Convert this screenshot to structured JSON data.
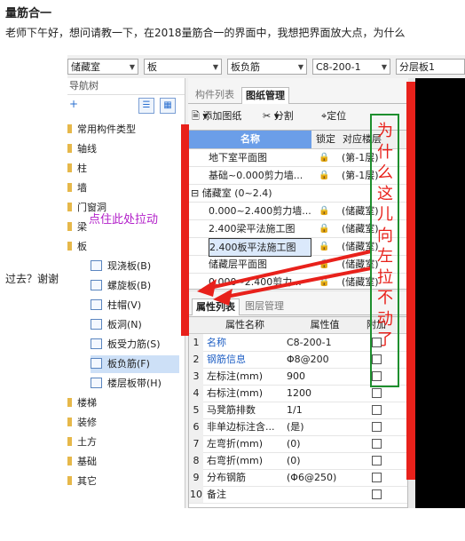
{
  "post": {
    "title": "量筋合一",
    "question_line1": "老师下午好，想问请教一下，在2018量筋合一的界面中，我想把界面放大点，为什么",
    "question_line2": "过去？谢谢"
  },
  "combos": [
    "储藏室",
    "板",
    "板负筋",
    "C8-200-1",
    "分层板1"
  ],
  "nav": {
    "header": "导航树",
    "add": "+",
    "categories": [
      "常用构件类型",
      "轴线",
      "柱",
      "墙",
      "门窗洞",
      "梁",
      "板",
      "楼梯",
      "装修",
      "土方",
      "基础",
      "其它"
    ],
    "sub_items": [
      "现浇板(B)",
      "螺旋板(B)",
      "柱帽(V)",
      "板洞(N)",
      "板受力筋(S)",
      "板负筋(F)",
      "楼层板带(H)"
    ],
    "selected": "板负筋(F)"
  },
  "upper_tabs": [
    "构件列表",
    "图纸管理"
  ],
  "toolbar": {
    "add_drawing": "添加图纸",
    "split": "分割",
    "locate": "定位"
  },
  "drawing_grid": {
    "headers": [
      "名称",
      "锁定",
      "对应楼层"
    ],
    "rows": [
      {
        "name": "地下室平面图",
        "floor": "(第-1层)"
      },
      {
        "name": "基础~0.000剪力墙...",
        "floor": "(第-1层)"
      },
      {
        "name": "储藏室 (0~2.4)",
        "group": true
      },
      {
        "name": "0.000~2.400剪力墙...",
        "floor": "(储藏室)"
      },
      {
        "name": "2.400梁平法施工图",
        "floor": "(储藏室)"
      },
      {
        "name": "2.400板平法施工图",
        "floor": "(储藏室)",
        "selected": true
      },
      {
        "name": "储藏层平面图",
        "floor": "(储藏室)"
      },
      {
        "name": "0.000~2.400剪力...",
        "floor": "(储藏室)"
      }
    ]
  },
  "lower_tabs": [
    "属性列表",
    "图层管理"
  ],
  "properties": {
    "headers": [
      "属性名称",
      "属性值",
      "附加"
    ],
    "rows": [
      {
        "i": "1",
        "name": "名称",
        "value": "C8-200-1",
        "blue": true
      },
      {
        "i": "2",
        "name": "钢筋信息",
        "value": "Φ8@200",
        "blue": true
      },
      {
        "i": "3",
        "name": "左标注(mm)",
        "value": "900"
      },
      {
        "i": "4",
        "name": "右标注(mm)",
        "value": "1200"
      },
      {
        "i": "5",
        "name": "马凳筋排数",
        "value": "1/1"
      },
      {
        "i": "6",
        "name": "非单边标注含...",
        "value": "(是)"
      },
      {
        "i": "7",
        "name": "左弯折(mm)",
        "value": "(0)"
      },
      {
        "i": "8",
        "name": "右弯折(mm)",
        "value": "(0)"
      },
      {
        "i": "9",
        "name": "分布钢筋",
        "value": "(Φ6@250)"
      },
      {
        "i": "10",
        "name": "备注",
        "value": ""
      }
    ]
  },
  "annotations": {
    "drag_hint": "点住此处拉动",
    "vertical_text": [
      "为",
      "什",
      "么",
      "这",
      "儿",
      "向",
      "左",
      "拉",
      "不",
      "动",
      "了"
    ],
    "red": "#e8211b",
    "green": "#1e8f2e"
  }
}
